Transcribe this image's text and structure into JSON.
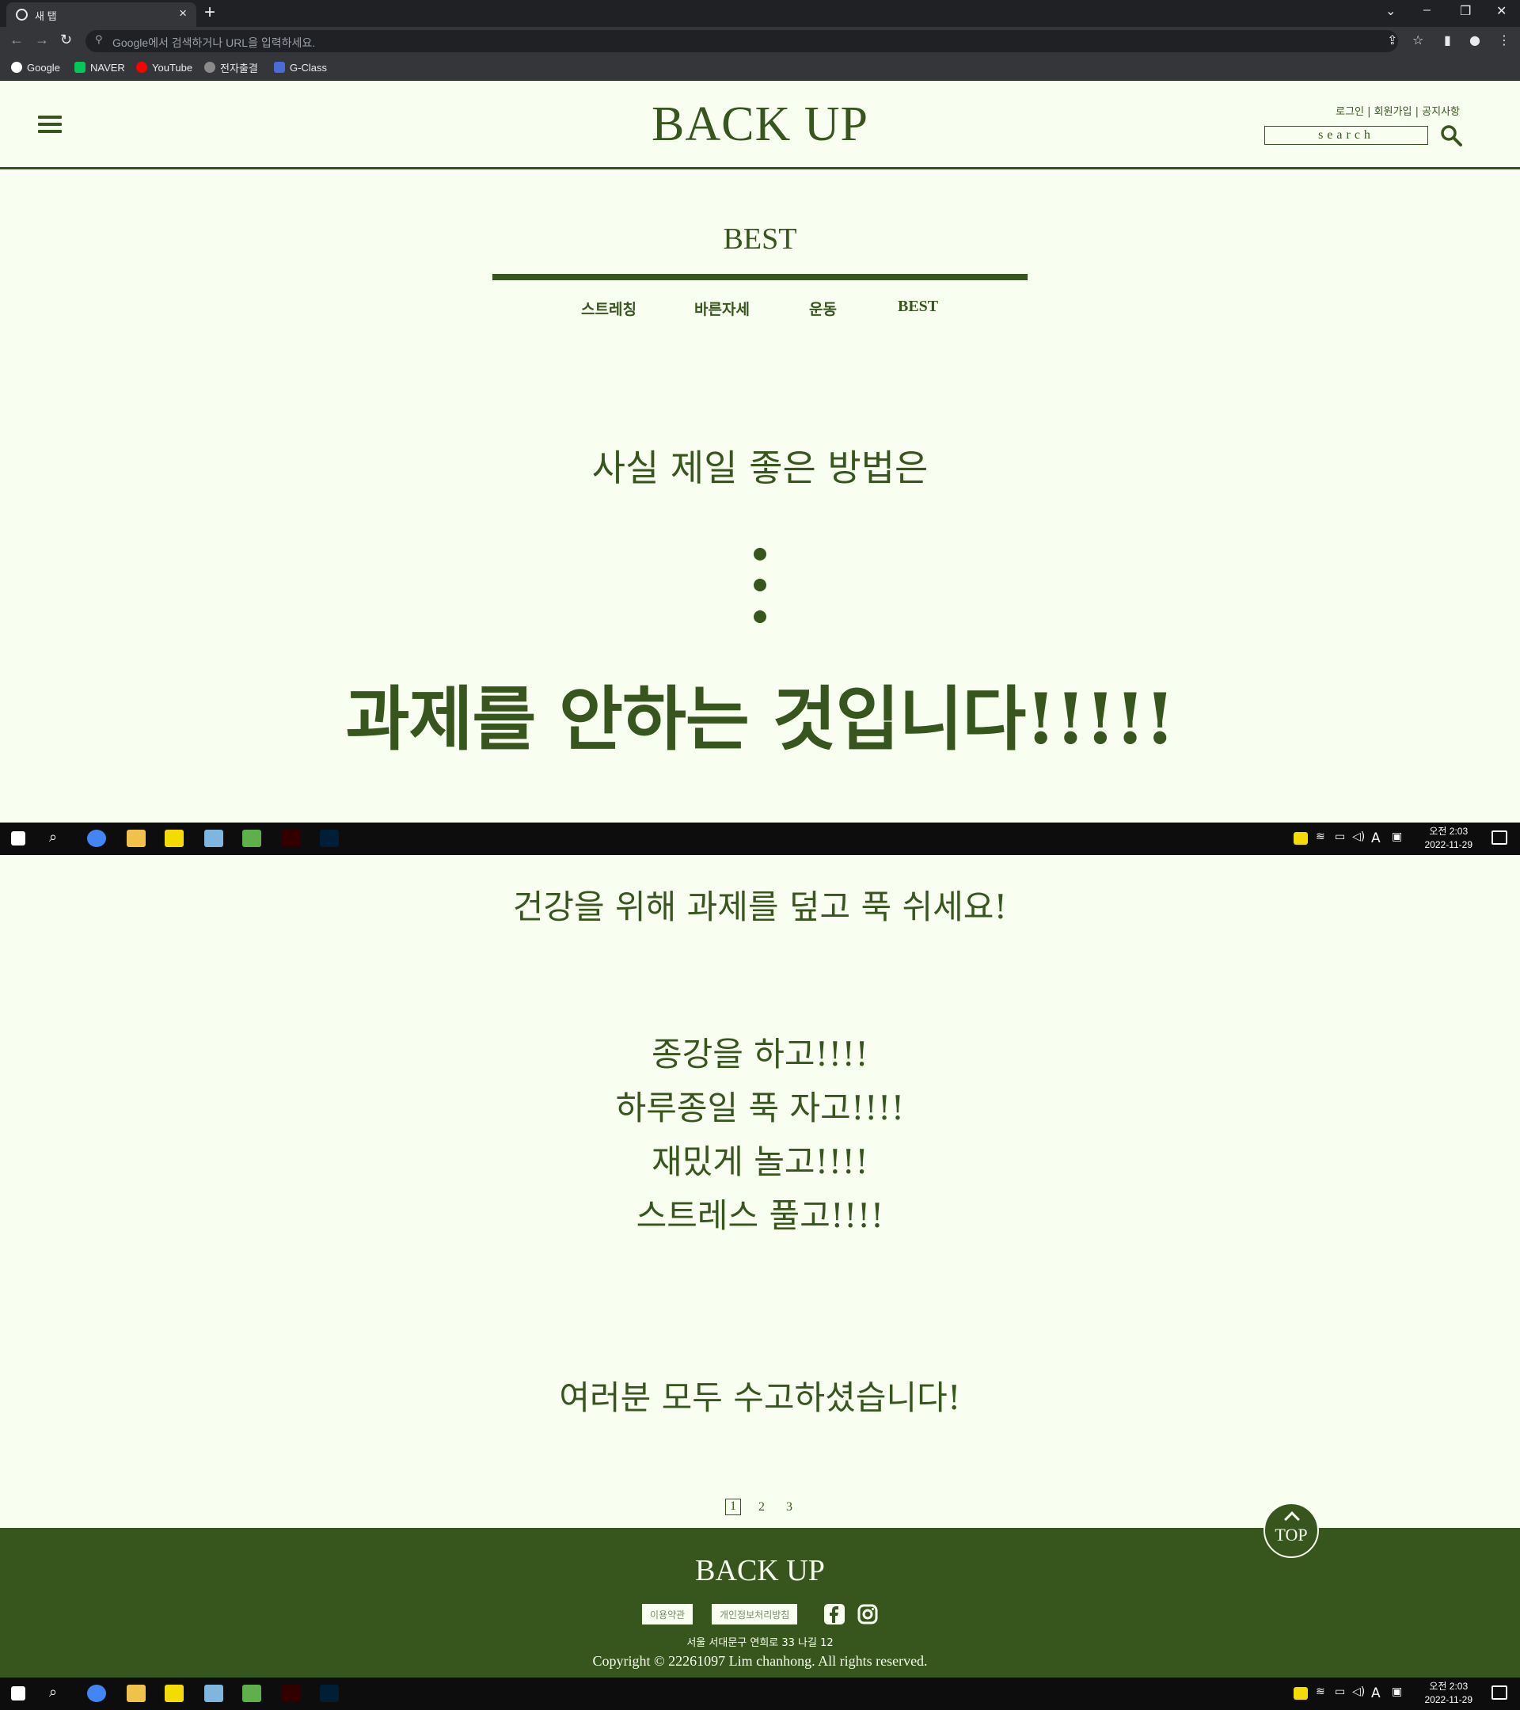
{
  "browser": {
    "tab_title": "새 탭",
    "omnibox_placeholder": "Google에서 검색하거나 URL을 입력하세요.",
    "bookmarks": [
      {
        "label": "Google",
        "color": "#ffffff"
      },
      {
        "label": "NAVER",
        "color": "#03c75a"
      },
      {
        "label": "YouTube",
        "color": "#ff0000"
      },
      {
        "label": "전자출결",
        "color": "#8a8a8a"
      },
      {
        "label": "G-Class",
        "color": "#4a6cd4"
      }
    ]
  },
  "header": {
    "logo": "BACK UP",
    "links": "로그인 | 회원가입 | 공지사항",
    "search_placeholder": "search"
  },
  "section": {
    "title": "BEST",
    "categories": [
      "스트레칭",
      "바른자세",
      "운동",
      "BEST"
    ]
  },
  "content": {
    "intro": "사실 제일 좋은 방법은",
    "headline": "과제를 안하는 것입니다!!!!!",
    "line_rest": "건강을 위해 과제를 덮고 푹 쉬세요!",
    "list": [
      "종강을 하고!!!!",
      "하루종일 푹 자고!!!!",
      "재밌게 놀고!!!!",
      "스트레스 풀고!!!!"
    ],
    "closing": "여러분 모두 수고하셨습니다!"
  },
  "pagination": {
    "pages": [
      "1",
      "2",
      "3"
    ],
    "current": "1"
  },
  "top_button": {
    "label": "TOP"
  },
  "footer": {
    "logo": "BACK UP",
    "terms": "이용약관",
    "privacy": "개인정보처리방침",
    "address": "서울 서대문구 연희로 33 나길 12",
    "copyright": "Copyright © 22261097 Lim chanhong. All rights reserved."
  },
  "taskbar": {
    "time_period": "오전 2:03",
    "date": "2022-11-29",
    "ime": "A"
  },
  "colors": {
    "brand_green": "#37561e",
    "background": "#f9fff0"
  }
}
